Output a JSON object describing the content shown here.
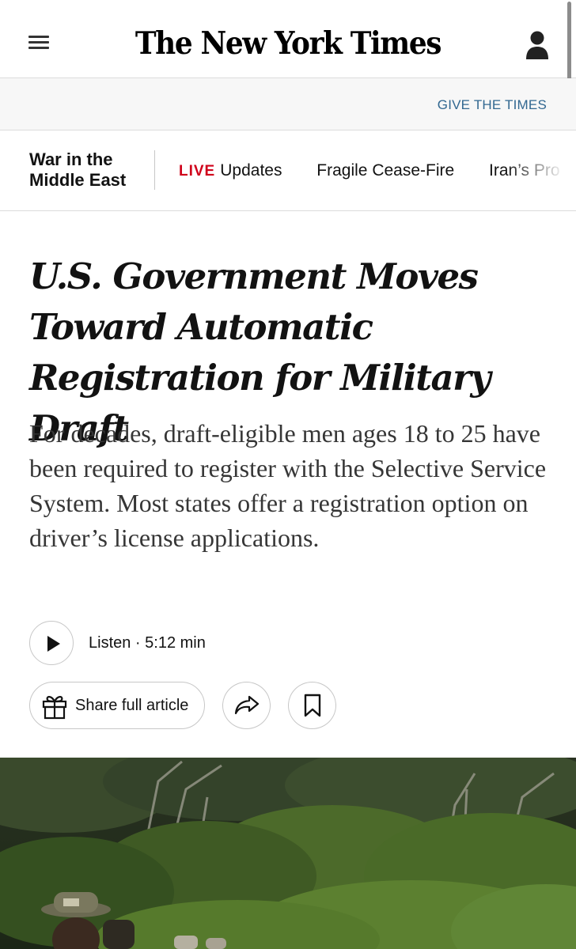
{
  "masthead": {
    "logo_text": "The New York Times",
    "menu_icon": "hamburger-menu-icon",
    "account_icon": "user-account-icon"
  },
  "banner": {
    "give_label": "GIVE THE TIMES"
  },
  "topic_nav": {
    "title": "War in the Middle East",
    "items": [
      {
        "live_tag": "LIVE",
        "label": "Updates"
      },
      {
        "label": "Fragile Cease-Fire"
      },
      {
        "label": "Iran’s Pro"
      }
    ]
  },
  "article": {
    "headline": "U.S. Government Moves Toward Automatic Registration for Military Draft",
    "summary": "For decades, draft-eligible men ages 18 to 25 have been required to register with the Selective Service System. Most states offer a registration option on driver’s license applications.",
    "listen_label": "Listen · 5:12 min",
    "share_label": "Share full article",
    "share_icon": "gift-icon",
    "forward_icon": "share-arrow-icon",
    "save_icon": "bookmark-icon"
  },
  "photo": {
    "description_icon": "article-lead-photo"
  },
  "colors": {
    "link_blue": "#326891",
    "live_red": "#d0021b",
    "text": "#121212",
    "border": "#c7c7c7"
  }
}
